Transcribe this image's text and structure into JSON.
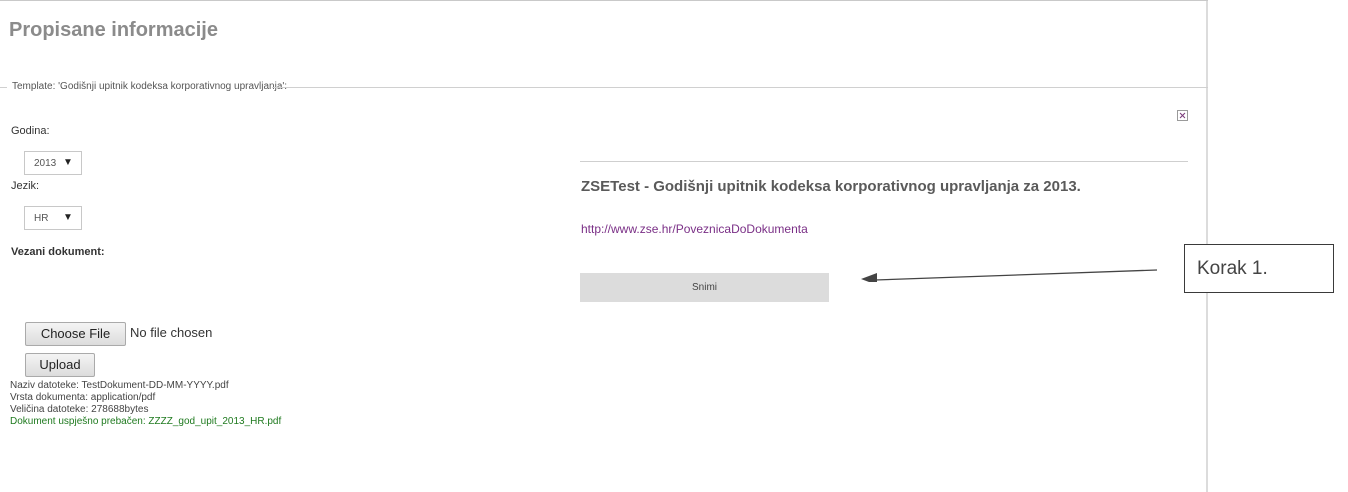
{
  "page_title": "Propisane informacije",
  "template_legend": "Template: 'Godišnji upitnik kodeksa korporativnog upravljanja':",
  "form": {
    "year_label": "Godina:",
    "year_value": "2013",
    "language_label": "Jezik:",
    "language_value": "HR",
    "linked_doc_label": "Vezani dokument:",
    "choose_file_label": "Choose File",
    "no_file_text": "No file chosen",
    "upload_label": "Upload",
    "info": [
      "Naziv datoteke: TestDokument-DD-MM-YYYY.pdf",
      "Vrsta dokumenta: application/pdf",
      "Veličina datoteke: 278688bytes"
    ],
    "success_text": "Dokument uspješno prebačen: ZZZZ_god_upit_2013_HR.pdf"
  },
  "preview": {
    "title": "ZSETest - Godišnji upitnik kodeksa korporativnog upravljanja za 2013.",
    "link": "http://www.zse.hr/PoveznicaDoDokumenta",
    "save_label": "Snimi"
  },
  "callout": {
    "text": "Korak 1."
  },
  "colors": {
    "title": "#8b8b8b",
    "link": "#7a2f86",
    "success": "#1f7a1f"
  }
}
